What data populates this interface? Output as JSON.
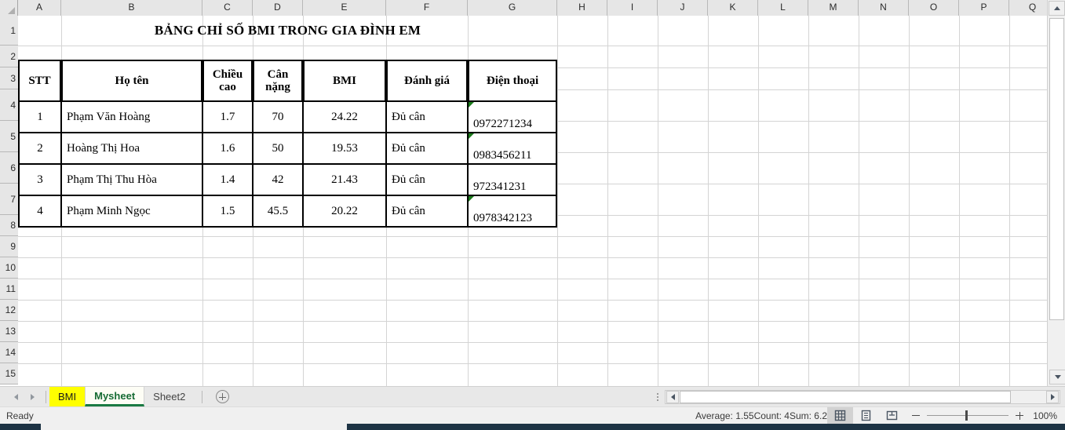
{
  "sheet": {
    "columns": [
      "A",
      "B",
      "C",
      "D",
      "E",
      "F",
      "G",
      "H",
      "I",
      "J",
      "K",
      "L",
      "M",
      "N",
      "O",
      "P",
      "Q"
    ],
    "rows": [
      "1",
      "2",
      "3",
      "4",
      "5",
      "6",
      "7",
      "8",
      "9",
      "10",
      "11",
      "12",
      "13",
      "14",
      "15"
    ],
    "title": "BẢNG CHỈ SỐ BMI TRONG GIA ĐÌNH EM"
  },
  "table": {
    "headers": {
      "stt": "STT",
      "name": "Họ tên",
      "height_l1": "Chiều",
      "height_l2": "cao",
      "weight_l1": "Cân",
      "weight_l2": "nặng",
      "bmi": "BMI",
      "rating": "Đánh giá",
      "phone": "Điện thoại"
    },
    "rows": [
      {
        "stt": "1",
        "name": "Phạm Văn Hoàng",
        "height": "1.7",
        "weight": "70",
        "bmi": "24.22",
        "rating": "Đủ cân",
        "phone": "0972271234",
        "error_flag": true
      },
      {
        "stt": "2",
        "name": "Hoàng Thị Hoa",
        "height": "1.6",
        "weight": "50",
        "bmi": "19.53",
        "rating": "Đủ cân",
        "phone": "0983456211",
        "error_flag": true
      },
      {
        "stt": "3",
        "name": "Phạm  Thị Thu Hòa",
        "height": "1.4",
        "weight": "42",
        "bmi": "21.43",
        "rating": "Đủ cân",
        "phone": "972341231",
        "error_flag": false
      },
      {
        "stt": "4",
        "name": "Phạm Minh Ngọc",
        "height": "1.5",
        "weight": "45.5",
        "bmi": "20.22",
        "rating": "Đủ cân",
        "phone": "0978342123",
        "error_flag": true
      }
    ]
  },
  "tabs": {
    "items": [
      {
        "label": "BMI",
        "state": "highlighted"
      },
      {
        "label": "Mysheet",
        "state": "active"
      },
      {
        "label": "Sheet2",
        "state": "normal"
      }
    ]
  },
  "status": {
    "ready": "Ready",
    "average": "Average: 1.55",
    "count": "Count: 4",
    "sum": "Sum: 6.2",
    "zoom": "100%"
  },
  "colors": {
    "tab_highlight": "#ffff00",
    "tab_active_text": "#166b33",
    "error_triangle": "#1a7a1a",
    "header_bg": "#e6e6e6"
  }
}
